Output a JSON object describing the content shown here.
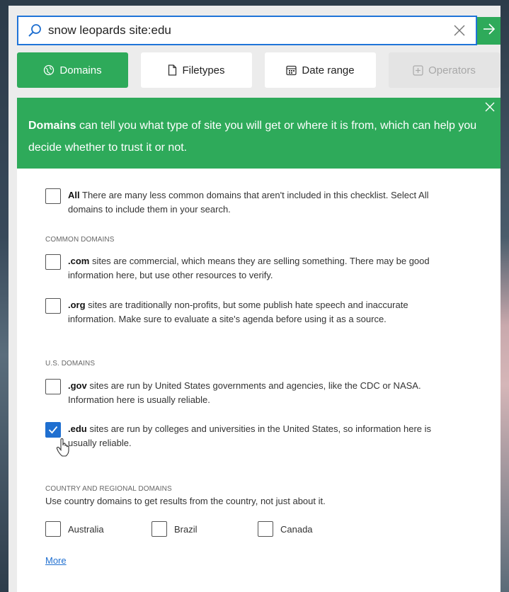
{
  "search": {
    "value": "snow leopards site:edu",
    "icon": "search-icon"
  },
  "tabs": [
    {
      "label": "Domains",
      "icon": "globe-icon",
      "state": "active"
    },
    {
      "label": "Filetypes",
      "icon": "file-icon",
      "state": "normal"
    },
    {
      "label": "Date range",
      "icon": "calendar-icon",
      "state": "normal"
    },
    {
      "label": "Operators",
      "icon": "plus-box-icon",
      "state": "disabled"
    }
  ],
  "banner": {
    "bold": "Domains",
    "text": " can tell you what type of site you will get or where it is from, which can help you decide whether to trust it or not."
  },
  "all_option": {
    "bold": "All",
    "text": " There are many less common domains that aren't included in this checklist. Select All domains to include them in your search.",
    "checked": false
  },
  "common": {
    "heading": "COMMON DOMAINS",
    "options": [
      {
        "bold": ".com",
        "text": " sites are commercial, which means they are selling something. There may be good information here, but use other resources to verify.",
        "checked": false
      },
      {
        "bold": ".org",
        "text": " sites are traditionally non-profits, but some publish hate speech and inaccurate information. Make sure to evaluate a site's agenda before using it as a source.",
        "checked": false
      }
    ]
  },
  "us": {
    "heading": "U.S. DOMAINS",
    "options": [
      {
        "bold": ".gov",
        "text": " sites are run by United States governments and agencies, like the CDC or NASA. Information here is usually reliable.",
        "checked": false
      },
      {
        "bold": ".edu",
        "text": " sites are run by colleges and universities in the United States, so information here is usually reliable.",
        "checked": true
      }
    ]
  },
  "country": {
    "heading": "COUNTRY AND REGIONAL DOMAINS",
    "note": "Use country domains to get results from the country, not just about it.",
    "options": [
      {
        "label": "Australia",
        "checked": false
      },
      {
        "label": "Brazil",
        "checked": false
      },
      {
        "label": "Canada",
        "checked": false
      }
    ]
  },
  "more_link": "More",
  "colors": {
    "accent_green": "#2eaa5a",
    "checkbox_blue": "#1f6fd0",
    "focus_border": "#1f74d8"
  }
}
